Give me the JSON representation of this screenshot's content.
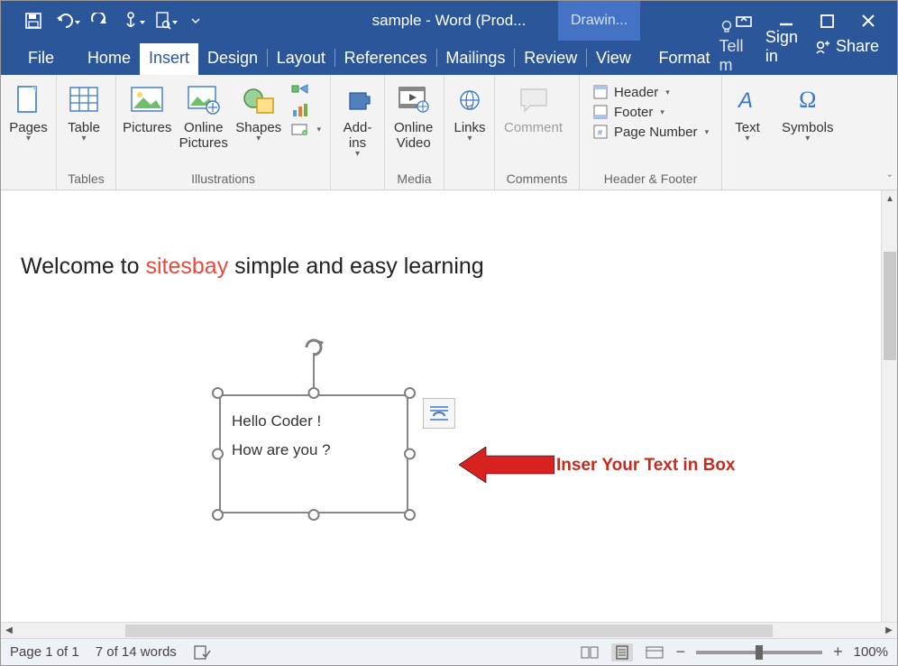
{
  "titlebar": {
    "title": "sample - Word (Prod...",
    "context_tab": "Drawin..."
  },
  "menu": {
    "tabs": [
      "File",
      "Home",
      "Insert",
      "Design",
      "Layout",
      "References",
      "Mailings",
      "Review",
      "View"
    ],
    "active": "Insert",
    "context_tab": "Format",
    "tell_me": "Tell m",
    "sign_in": "Sign in",
    "share": "Share"
  },
  "ribbon": {
    "pages": {
      "label": "Pages"
    },
    "tables": {
      "group": "Tables",
      "label": "Table"
    },
    "illus": {
      "group": "Illustrations",
      "pictures": "Pictures",
      "online_pictures": "Online\nPictures",
      "shapes": "Shapes"
    },
    "addins": {
      "label": "Add-\nins"
    },
    "media": {
      "group": "Media",
      "label": "Online\nVideo"
    },
    "links": {
      "label": "Links"
    },
    "comments": {
      "group": "Comments",
      "label": "Comment"
    },
    "hf": {
      "group": "Header & Footer",
      "header": "Header",
      "footer": "Footer",
      "pagenum": "Page Number"
    },
    "text": {
      "label": "Text"
    },
    "symbols": {
      "label": "Symbols"
    }
  },
  "document": {
    "heading_pre": "Welcome to ",
    "heading_brand": "sitesbay",
    "heading_post": " simple and easy learning",
    "textbox_line1": "Hello Coder !",
    "textbox_line2": "How are you ?",
    "annotation": "Inser Your Text in Box"
  },
  "status": {
    "page": "Page 1 of 1",
    "words": "7 of 14 words",
    "zoom": "100%"
  }
}
